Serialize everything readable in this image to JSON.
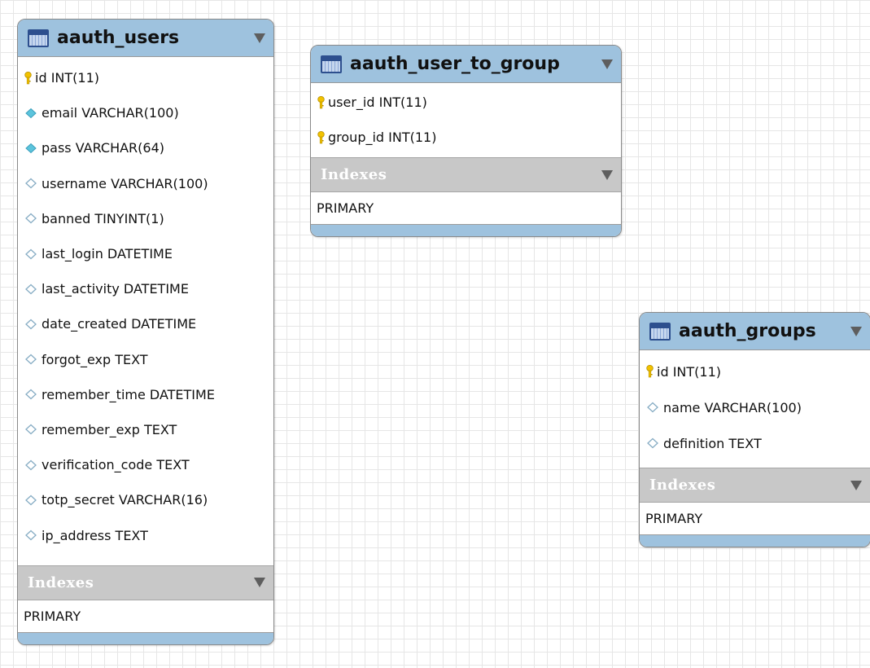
{
  "tables": [
    {
      "name": "aauth_users",
      "columns": [
        {
          "name": "id INT(11)",
          "kind": "primary-key"
        },
        {
          "name": "email VARCHAR(100)",
          "kind": "non-null"
        },
        {
          "name": "pass VARCHAR(64)",
          "kind": "non-null"
        },
        {
          "name": "username VARCHAR(100)",
          "kind": "nullable"
        },
        {
          "name": "banned TINYINT(1)",
          "kind": "nullable"
        },
        {
          "name": "last_login DATETIME",
          "kind": "nullable"
        },
        {
          "name": "last_activity DATETIME",
          "kind": "nullable"
        },
        {
          "name": "date_created DATETIME",
          "kind": "nullable"
        },
        {
          "name": "forgot_exp TEXT",
          "kind": "nullable"
        },
        {
          "name": "remember_time DATETIME",
          "kind": "nullable"
        },
        {
          "name": "remember_exp TEXT",
          "kind": "nullable"
        },
        {
          "name": "verification_code TEXT",
          "kind": "nullable"
        },
        {
          "name": "totp_secret VARCHAR(16)",
          "kind": "nullable"
        },
        {
          "name": "ip_address TEXT",
          "kind": "nullable"
        }
      ],
      "indexes_label": "Indexes",
      "indexes": [
        "PRIMARY"
      ]
    },
    {
      "name": "aauth_user_to_group",
      "columns": [
        {
          "name": "user_id INT(11)",
          "kind": "primary-key"
        },
        {
          "name": "group_id INT(11)",
          "kind": "primary-key"
        }
      ],
      "indexes_label": "Indexes",
      "indexes": [
        "PRIMARY"
      ]
    },
    {
      "name": "aauth_groups",
      "columns": [
        {
          "name": "id INT(11)",
          "kind": "primary-key"
        },
        {
          "name": "name VARCHAR(100)",
          "kind": "nullable"
        },
        {
          "name": "definition TEXT",
          "kind": "nullable"
        }
      ],
      "indexes_label": "Indexes",
      "indexes": [
        "PRIMARY"
      ]
    }
  ],
  "icons": {
    "primary-key": "key-icon",
    "non-null": "filled-diamond-icon",
    "nullable": "hollow-diamond-icon",
    "table": "table-icon",
    "collapse": "chevron-down-icon"
  },
  "colors": {
    "header": "#9ec2de",
    "indexes_bar": "#c8c8c8",
    "key": "#f2c200",
    "filled_diamond": "#5cc4dc",
    "hollow_diamond": "#86acc4"
  }
}
